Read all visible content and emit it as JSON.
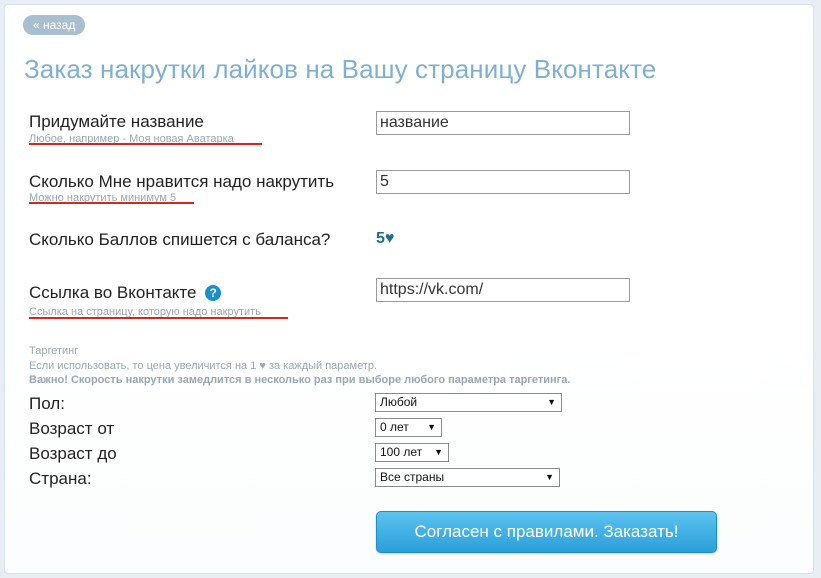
{
  "back_label": "« назад",
  "page_title": "Заказ накрутки лайков на Вашу страницу Вконтакте",
  "fields": {
    "name": {
      "label": "Придумайте название",
      "hint": "Любое, например - Моя новая Аватарка",
      "value": "название"
    },
    "likes": {
      "label": "Сколько Мне нравится надо накрутить",
      "hint": "Можно накрутить минимум 5",
      "value": "5"
    },
    "points": {
      "label": "Сколько Баллов спишется с баланса?",
      "value": "5♥"
    },
    "link": {
      "label": "Ссылка во Вконтакте",
      "hint": "Ссылка на страницу, которую надо накрутить",
      "value": "https://vk.com/"
    }
  },
  "help_icon": "question-mark-icon",
  "targeting": {
    "title": "Таргетинг",
    "note": "Если использовать, то цена увеличится на 1 ♥ за каждый параметр.",
    "warning": "Важно! Скорость накрутки замедлится в несколько раз при выборе любого параметра таргетинга.",
    "gender": {
      "label": "Пол:",
      "selected": "Любой"
    },
    "age_from": {
      "label": "Возраст от",
      "selected": "0 лет"
    },
    "age_to": {
      "label": "Возраст до",
      "selected": "100 лет"
    },
    "country": {
      "label": "Страна:",
      "selected": "Все страны"
    }
  },
  "submit_label": "Согласен с правилами. Заказать!",
  "colors": {
    "title": "#7fb0d3",
    "hint_underline": "#d9261c",
    "button": "#2c9fd9",
    "points_value": "#1e6f8e"
  }
}
